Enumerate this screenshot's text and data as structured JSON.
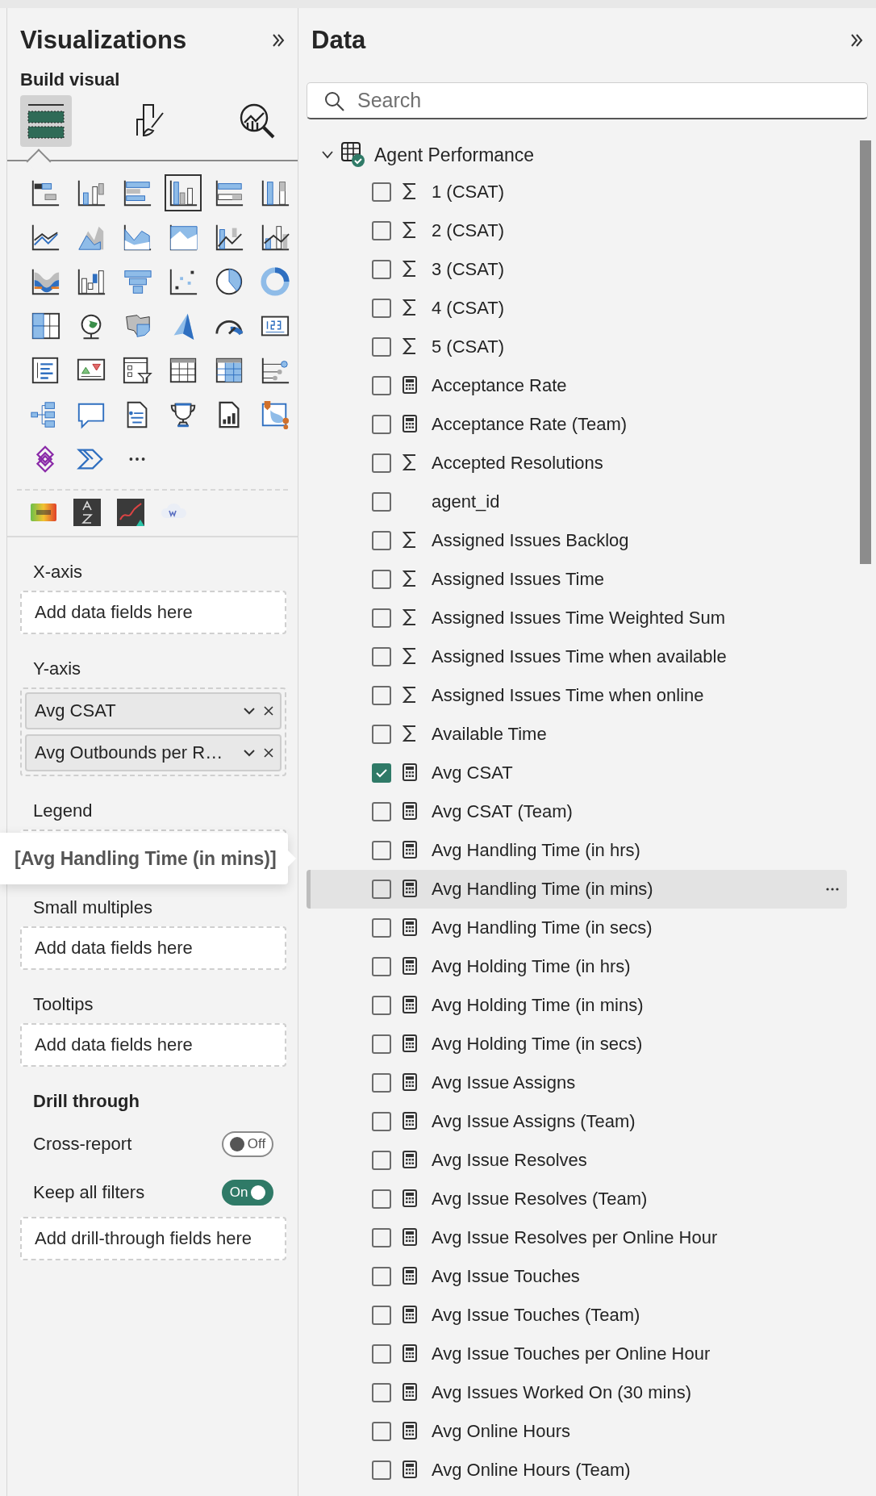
{
  "visualizations": {
    "title": "Visualizations",
    "section": "Build visual",
    "build_tabs": [
      {
        "kind": "fields",
        "selected": true
      },
      {
        "kind": "format",
        "selected": false
      },
      {
        "kind": "analytics",
        "selected": false
      }
    ],
    "gallery": [
      {
        "kind": "stacked-bar",
        "selected": false
      },
      {
        "kind": "stacked-column",
        "selected": false
      },
      {
        "kind": "clustered-bar",
        "selected": false
      },
      {
        "kind": "clustered-column",
        "selected": true
      },
      {
        "kind": "full-bar",
        "selected": false
      },
      {
        "kind": "full-column",
        "selected": false
      },
      {
        "kind": "line",
        "selected": false
      },
      {
        "kind": "area",
        "selected": false
      },
      {
        "kind": "stacked-area",
        "selected": false
      },
      {
        "kind": "full-area",
        "selected": false
      },
      {
        "kind": "line-column",
        "selected": false
      },
      {
        "kind": "line-clustered",
        "selected": false
      },
      {
        "kind": "ribbon",
        "selected": false
      },
      {
        "kind": "waterfall",
        "selected": false
      },
      {
        "kind": "funnel",
        "selected": false
      },
      {
        "kind": "scatter",
        "selected": false
      },
      {
        "kind": "pie",
        "selected": false
      },
      {
        "kind": "donut",
        "selected": false
      },
      {
        "kind": "treemap",
        "selected": false
      },
      {
        "kind": "globe",
        "selected": false
      },
      {
        "kind": "filled-map",
        "selected": false
      },
      {
        "kind": "arrowhead",
        "selected": false
      },
      {
        "kind": "gauge",
        "selected": false
      },
      {
        "kind": "number-card",
        "selected": false
      },
      {
        "kind": "multi-row-card",
        "selected": false
      },
      {
        "kind": "kpi",
        "selected": false
      },
      {
        "kind": "slicer",
        "selected": false
      },
      {
        "kind": "table",
        "selected": false
      },
      {
        "kind": "matrix",
        "selected": false
      },
      {
        "kind": "influencers",
        "selected": false
      },
      {
        "kind": "tree",
        "selected": false
      },
      {
        "kind": "speech-bubble",
        "selected": false
      },
      {
        "kind": "document",
        "selected": false
      },
      {
        "kind": "trophy",
        "selected": false
      },
      {
        "kind": "report-page",
        "selected": false
      },
      {
        "kind": "pin-map",
        "selected": false
      },
      {
        "kind": "diamond",
        "selected": false
      },
      {
        "kind": "chevron",
        "selected": false
      },
      {
        "kind": "more",
        "selected": false
      }
    ],
    "custom_visuals": [
      {
        "kind": "heat-number"
      },
      {
        "kind": "sort-letters"
      },
      {
        "kind": "dark-line"
      },
      {
        "kind": "cloud"
      }
    ],
    "wells": [
      {
        "label": "X-axis",
        "placeholder": "Add data fields here"
      },
      {
        "label": "Y-axis",
        "fields": [
          {
            "name": "Avg CSAT"
          },
          {
            "name": "Avg Outbounds per R…"
          }
        ]
      },
      {
        "label": "Legend",
        "tooltip": "[Avg Handling Time (in mins)]"
      },
      {
        "label": "Small multiples",
        "placeholder": "Add data fields here"
      },
      {
        "label": "Tooltips",
        "placeholder": "Add data fields here"
      }
    ],
    "drill_through": {
      "title": "Drill through",
      "switches": [
        {
          "label": "Cross-report",
          "on": false,
          "state_text": "Off"
        },
        {
          "label": "Keep all filters",
          "on": true,
          "state_text": "On"
        }
      ],
      "placeholder": "Add drill-through fields here"
    }
  },
  "data": {
    "title": "Data",
    "search": {
      "placeholder": "Search"
    },
    "table": {
      "name": "Agent Performance",
      "expanded": true,
      "fields": [
        {
          "name": "1 (CSAT)",
          "kind": "sum",
          "checked": false,
          "hovered": false
        },
        {
          "name": "2 (CSAT)",
          "kind": "sum",
          "checked": false,
          "hovered": false
        },
        {
          "name": "3 (CSAT)",
          "kind": "sum",
          "checked": false,
          "hovered": false
        },
        {
          "name": "4 (CSAT)",
          "kind": "sum",
          "checked": false,
          "hovered": false
        },
        {
          "name": "5 (CSAT)",
          "kind": "sum",
          "checked": false,
          "hovered": false
        },
        {
          "name": "Acceptance Rate",
          "kind": "measure",
          "checked": false,
          "hovered": false
        },
        {
          "name": "Acceptance Rate (Team)",
          "kind": "measure",
          "checked": false,
          "hovered": false
        },
        {
          "name": "Accepted Resolutions",
          "kind": "sum",
          "checked": false,
          "hovered": false
        },
        {
          "name": "agent_id",
          "kind": "plain",
          "checked": false,
          "hovered": false
        },
        {
          "name": "Assigned Issues Backlog",
          "kind": "sum",
          "checked": false,
          "hovered": false
        },
        {
          "name": "Assigned Issues Time",
          "kind": "sum",
          "checked": false,
          "hovered": false
        },
        {
          "name": "Assigned Issues Time Weighted Sum",
          "kind": "sum",
          "checked": false,
          "hovered": false
        },
        {
          "name": "Assigned Issues Time when available",
          "kind": "sum",
          "checked": false,
          "hovered": false
        },
        {
          "name": "Assigned Issues Time when online",
          "kind": "sum",
          "checked": false,
          "hovered": false
        },
        {
          "name": "Available Time",
          "kind": "sum",
          "checked": false,
          "hovered": false
        },
        {
          "name": "Avg CSAT",
          "kind": "measure",
          "checked": true,
          "hovered": false
        },
        {
          "name": "Avg CSAT (Team)",
          "kind": "measure",
          "checked": false,
          "hovered": false
        },
        {
          "name": "Avg Handling Time (in hrs)",
          "kind": "measure",
          "checked": false,
          "hovered": false
        },
        {
          "name": "Avg Handling Time (in mins)",
          "kind": "measure",
          "checked": false,
          "hovered": true
        },
        {
          "name": "Avg Handling Time (in secs)",
          "kind": "measure",
          "checked": false,
          "hovered": false
        },
        {
          "name": "Avg Holding Time (in hrs)",
          "kind": "measure",
          "checked": false,
          "hovered": false
        },
        {
          "name": "Avg Holding Time (in mins)",
          "kind": "measure",
          "checked": false,
          "hovered": false
        },
        {
          "name": "Avg Holding Time (in secs)",
          "kind": "measure",
          "checked": false,
          "hovered": false
        },
        {
          "name": "Avg Issue Assigns",
          "kind": "measure",
          "checked": false,
          "hovered": false
        },
        {
          "name": "Avg Issue Assigns (Team)",
          "kind": "measure",
          "checked": false,
          "hovered": false
        },
        {
          "name": "Avg Issue Resolves",
          "kind": "measure",
          "checked": false,
          "hovered": false
        },
        {
          "name": "Avg Issue Resolves (Team)",
          "kind": "measure",
          "checked": false,
          "hovered": false
        },
        {
          "name": "Avg Issue Resolves per Online Hour",
          "kind": "measure",
          "checked": false,
          "hovered": false
        },
        {
          "name": "Avg Issue Touches",
          "kind": "measure",
          "checked": false,
          "hovered": false
        },
        {
          "name": "Avg Issue Touches (Team)",
          "kind": "measure",
          "checked": false,
          "hovered": false
        },
        {
          "name": "Avg Issue Touches per Online Hour",
          "kind": "measure",
          "checked": false,
          "hovered": false
        },
        {
          "name": "Avg Issues Worked On (30 mins)",
          "kind": "measure",
          "checked": false,
          "hovered": false
        },
        {
          "name": "Avg Online Hours",
          "kind": "measure",
          "checked": false,
          "hovered": false
        },
        {
          "name": "Avg Online Hours (Team)",
          "kind": "measure",
          "checked": false,
          "hovered": false
        }
      ]
    }
  }
}
